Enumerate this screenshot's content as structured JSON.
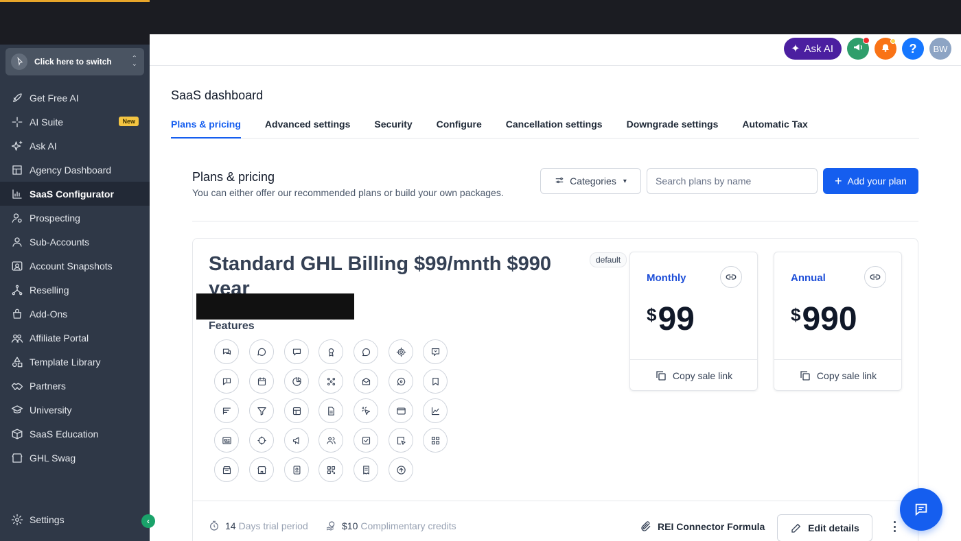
{
  "sidebar": {
    "switcher_label": "Click here to switch",
    "items": [
      {
        "label": "Get Free AI",
        "icon": "rocket-icon"
      },
      {
        "label": "AI Suite",
        "icon": "sparkle-icon",
        "badge": "New"
      },
      {
        "label": "Ask AI",
        "icon": "sparkles-icon"
      },
      {
        "label": "Agency Dashboard",
        "icon": "dashboard-icon"
      },
      {
        "label": "SaaS Configurator",
        "icon": "chart-icon",
        "active": true
      },
      {
        "label": "Prospecting",
        "icon": "user-search-icon"
      },
      {
        "label": "Sub-Accounts",
        "icon": "user-icon"
      },
      {
        "label": "Account Snapshots",
        "icon": "snapshot-icon"
      },
      {
        "label": "Reselling",
        "icon": "network-icon"
      },
      {
        "label": "Add-Ons",
        "icon": "bag-icon"
      },
      {
        "label": "Affiliate Portal",
        "icon": "users-icon"
      },
      {
        "label": "Template Library",
        "icon": "shapes-icon"
      },
      {
        "label": "Partners",
        "icon": "handshake-icon"
      },
      {
        "label": "University",
        "icon": "graduation-cap-icon"
      },
      {
        "label": "SaaS Education",
        "icon": "box-icon"
      },
      {
        "label": "GHL Swag",
        "icon": "store-icon"
      }
    ],
    "settings_label": "Settings"
  },
  "header": {
    "ask_ai_label": "Ask AI",
    "avatar_initials": "BW",
    "help_label": "?"
  },
  "main": {
    "page_title": "SaaS dashboard",
    "tabs": [
      {
        "label": "Plans & pricing",
        "active": true
      },
      {
        "label": "Advanced settings"
      },
      {
        "label": "Security"
      },
      {
        "label": "Configure"
      },
      {
        "label": "Cancellation settings"
      },
      {
        "label": "Downgrade settings"
      },
      {
        "label": "Automatic Tax"
      }
    ],
    "section_title": "Plans & pricing",
    "section_subtitle": "You can either offer our recommended plans or build your own packages.",
    "categories_label": "Categories",
    "search_placeholder": "Search plans by name",
    "add_plan_label": "Add your plan"
  },
  "plan": {
    "name": "Standard GHL Billing $99/mnth $990 year",
    "default_badge": "default",
    "features_label": "Features",
    "prices": [
      {
        "period": "Monthly",
        "currency": "$",
        "amount": "99",
        "copy_label": "Copy sale link"
      },
      {
        "period": "Annual",
        "currency": "$",
        "amount": "990",
        "copy_label": "Copy sale link"
      }
    ],
    "trial_days": "14",
    "trial_label": "Days trial period",
    "credits_amount": "$10",
    "credits_label": "Complimentary credits",
    "connector_label": "REI Connector Formula",
    "edit_label": "Edit details"
  },
  "colors": {
    "accent": "#155eef",
    "sidebar_bg": "#2f3847",
    "header_bg": "#1b1c22",
    "ask_ai": "#4b1fa0"
  }
}
